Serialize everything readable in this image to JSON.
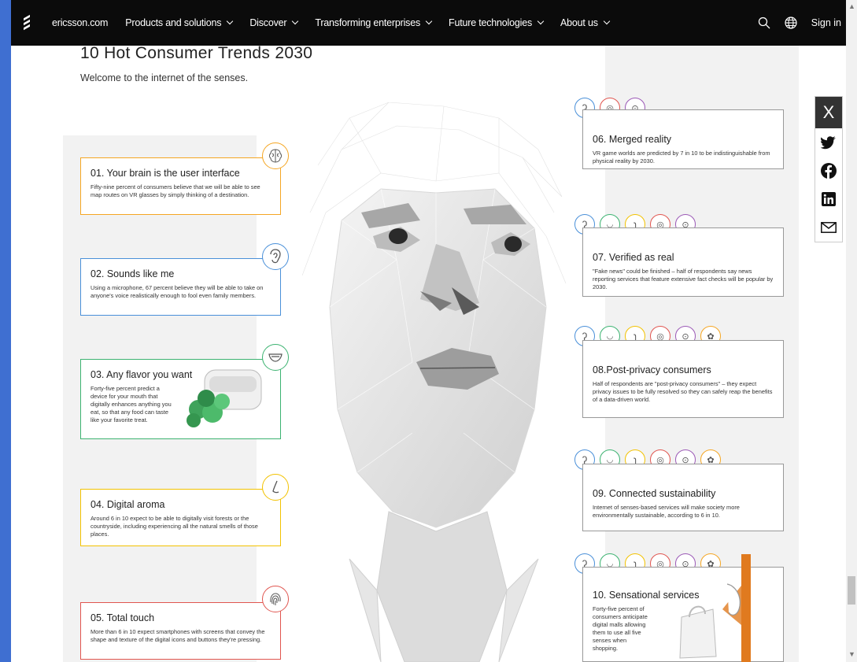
{
  "nav": {
    "items": [
      {
        "label": "ericsson.com",
        "chevron": false
      },
      {
        "label": "Products and solutions",
        "chevron": true
      },
      {
        "label": "Discover",
        "chevron": true
      },
      {
        "label": "Transforming enterprises",
        "chevron": true
      },
      {
        "label": "Future technologies",
        "chevron": true
      },
      {
        "label": "About us",
        "chevron": true
      }
    ],
    "sign_in": "Sign in",
    "icons": [
      "search-icon",
      "globe-icon"
    ]
  },
  "page": {
    "title": "10 Hot Consumer Trends 2030",
    "subtitle": "Welcome to the internet of the senses."
  },
  "colors": {
    "brain": "#f5a623",
    "ear": "#4a90d9",
    "taste": "#3cb371",
    "smell": "#f2c200",
    "touch": "#e0554f",
    "sight": "#9b59b6",
    "neutral": "#999999"
  },
  "trends_left": [
    {
      "title": "01. Your brain is the user interface",
      "text": "Fifty-nine percent of consumers believe that we will be able to see map routes on VR glasses by simply thinking of a destination.",
      "icon": "brain-icon"
    },
    {
      "title": "02. Sounds like me",
      "text": "Using a microphone, 67 percent believe they will be able to take on anyone's voice realistically enough to fool even family members.",
      "icon": "ear-icon"
    },
    {
      "title": "03. Any flavor you want",
      "text": "Forty-five percent predict a device for your mouth that digitally enhances anything you eat, so that any food can taste like your favorite treat.",
      "icon": "mouth-icon"
    },
    {
      "title": "04. Digital aroma",
      "text": "Around 6 in 10 expect to be able to digitally visit forests or the countryside, including experiencing all the natural smells of those places.",
      "icon": "nose-icon"
    },
    {
      "title": "05. Total touch",
      "text": "More than 6 in 10 expect smartphones with screens that convey the shape and texture of the digital icons and buttons they're pressing.",
      "icon": "fingerprint-icon"
    }
  ],
  "trends_right": [
    {
      "title": "06. Merged reality",
      "text": "VR game worlds are predicted by 7 in 10 to be indistinguishable from physical reality by 2030."
    },
    {
      "title": "07. Verified as real",
      "text": "\"Fake news\" could be finished – half of respondents say news reporting services that feature extensive fact checks will be popular by 2030."
    },
    {
      "title": "08.Post-privacy consumers",
      "text": "Half of respondents are \"post-privacy consumers\" – they expect privacy issues to be fully resolved so they can safely reap the benefits of a data-driven world."
    },
    {
      "title": "09. Connected sustainability",
      "text": "Internet of senses-based services will make society more environmentally sustainable, according to 6 in 10."
    },
    {
      "title": "10. Sensational services",
      "text": "Forty-five percent of consumers anticipate digital malls allowing them to use all five senses when shopping."
    }
  ],
  "share": {
    "close": "X",
    "icons": [
      "twitter-icon",
      "facebook-icon",
      "linkedin-icon",
      "email-icon"
    ]
  }
}
